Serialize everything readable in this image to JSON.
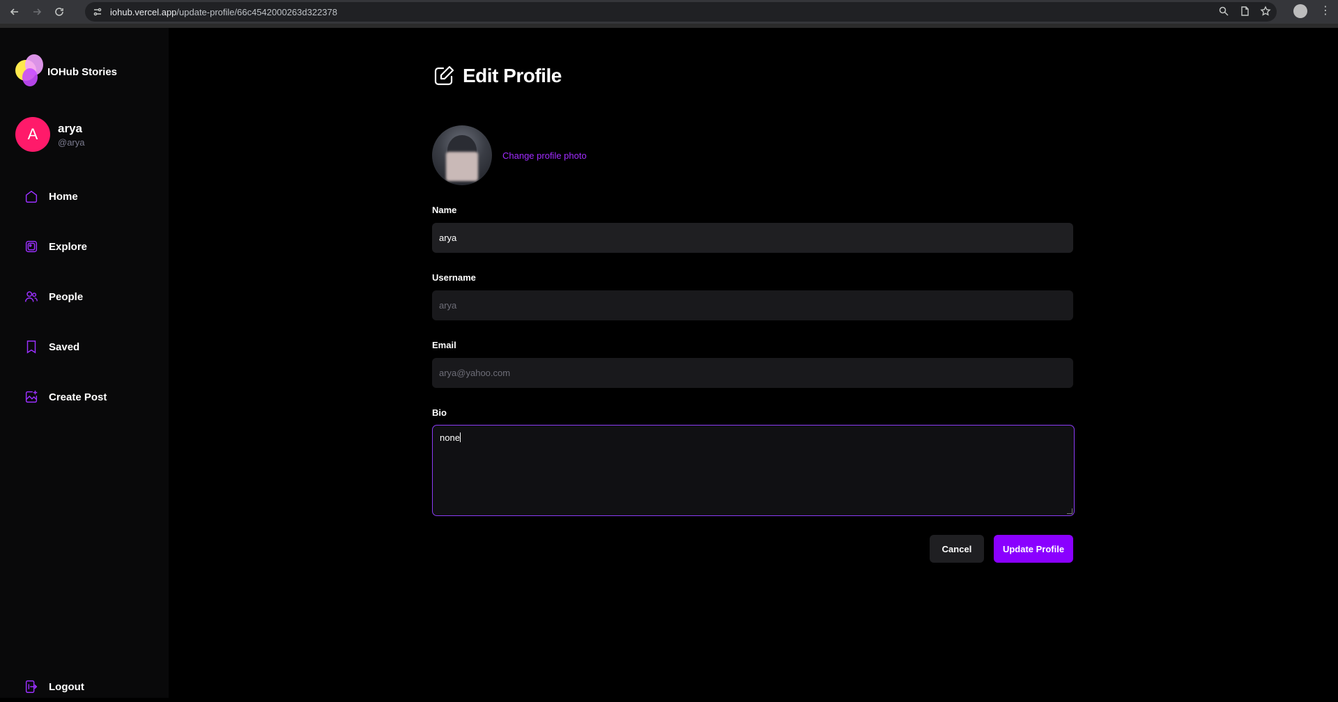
{
  "browser": {
    "url_host": "iohub.vercel.app",
    "url_path": "/update-profile/66c4542000263d322378"
  },
  "sidebar": {
    "logo_text": "IOHub Stories",
    "user": {
      "initial": "A",
      "name": "arya",
      "handle": "@arya"
    },
    "items": [
      {
        "label": "Home",
        "icon": "home-icon"
      },
      {
        "label": "Explore",
        "icon": "explore-icon"
      },
      {
        "label": "People",
        "icon": "people-icon"
      },
      {
        "label": "Saved",
        "icon": "saved-icon"
      },
      {
        "label": "Create Post",
        "icon": "create-post-icon"
      }
    ],
    "logout_label": "Logout"
  },
  "page": {
    "title": "Edit Profile",
    "change_photo_label": "Change profile photo",
    "form": {
      "name_label": "Name",
      "name_value": "arya",
      "username_label": "Username",
      "username_value": "arya",
      "email_label": "Email",
      "email_value": "arya@yahoo.com",
      "bio_label": "Bio",
      "bio_value": "none"
    },
    "cancel_label": "Cancel",
    "update_label": "Update Profile"
  },
  "colors": {
    "accent": "#8a00ff",
    "link": "#a12cff",
    "avatar": "#ff1a6a"
  }
}
